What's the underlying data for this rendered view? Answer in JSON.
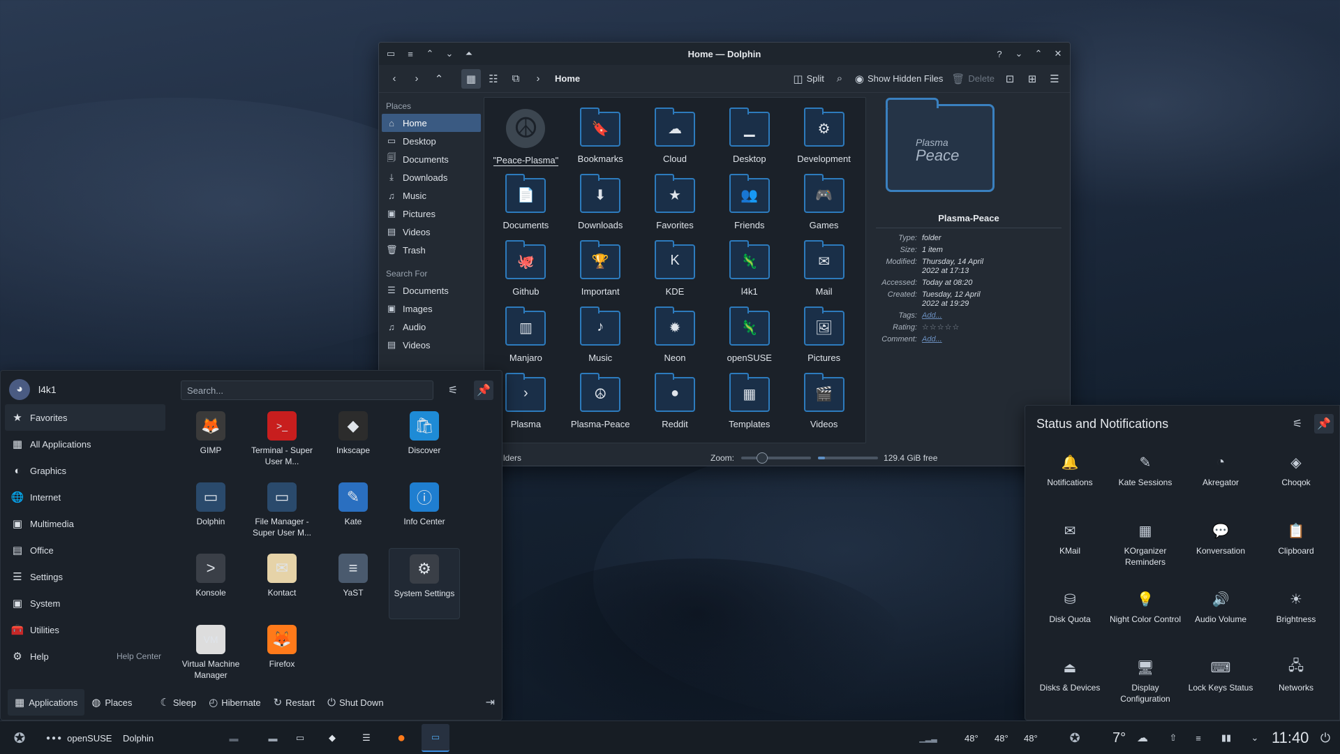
{
  "window": {
    "title": "Home — Dolphin",
    "buttons": {
      "help": "?",
      "minimize": "⌄",
      "maximize": "⌃",
      "close": "✕"
    }
  },
  "toolbar": {
    "breadcrumb": "Home",
    "split_label": "Split",
    "show_hidden_label": "Show Hidden Files",
    "delete_label": "Delete"
  },
  "places": {
    "header": "Places",
    "items": [
      {
        "label": "Home",
        "icon": "⌂"
      },
      {
        "label": "Desktop",
        "icon": "▭"
      },
      {
        "label": "Documents",
        "icon": "🗐"
      },
      {
        "label": "Downloads",
        "icon": "⤓"
      },
      {
        "label": "Music",
        "icon": "♫"
      },
      {
        "label": "Pictures",
        "icon": "▣"
      },
      {
        "label": "Videos",
        "icon": "▤"
      },
      {
        "label": "Trash",
        "icon": "🗑"
      }
    ],
    "search_header": "Search For",
    "search_items": [
      {
        "label": "Documents",
        "icon": "☰"
      },
      {
        "label": "Images",
        "icon": "▣"
      },
      {
        "label": "Audio",
        "icon": "♫"
      },
      {
        "label": "Videos",
        "icon": "▤"
      }
    ]
  },
  "files": [
    {
      "label": "\"Peace-Plasma\"",
      "icon": "☮"
    },
    {
      "label": "Bookmarks",
      "icon": "🔖"
    },
    {
      "label": "Cloud",
      "icon": "☁"
    },
    {
      "label": "Desktop",
      "icon": "▁"
    },
    {
      "label": "Development",
      "icon": "⚙"
    },
    {
      "label": "Documents",
      "icon": "📄"
    },
    {
      "label": "Downloads",
      "icon": "⬇"
    },
    {
      "label": "Favorites",
      "icon": "★"
    },
    {
      "label": "Friends",
      "icon": "👥"
    },
    {
      "label": "Games",
      "icon": "🎮"
    },
    {
      "label": "Github",
      "icon": "🐙"
    },
    {
      "label": "Important",
      "icon": "🏆"
    },
    {
      "label": "KDE",
      "icon": "K"
    },
    {
      "label": "l4k1",
      "icon": "🦎"
    },
    {
      "label": "Mail",
      "icon": "✉"
    },
    {
      "label": "Manjaro",
      "icon": "▥"
    },
    {
      "label": "Music",
      "icon": "♪"
    },
    {
      "label": "Neon",
      "icon": "✹"
    },
    {
      "label": "openSUSE",
      "icon": "🦎"
    },
    {
      "label": "Pictures",
      "icon": "🖼"
    },
    {
      "label": "Plasma",
      "icon": "›"
    },
    {
      "label": "Plasma-Peace",
      "icon": "☮"
    },
    {
      "label": "Reddit",
      "icon": "●"
    },
    {
      "label": "Templates",
      "icon": "▦"
    },
    {
      "label": "Videos",
      "icon": "🎬"
    }
  ],
  "info_panel": {
    "preview_small": "Plasma",
    "preview_big": "Peace",
    "name": "Plasma-Peace",
    "type_key": "Type:",
    "type": "folder",
    "size_key": "Size:",
    "size": "1 item",
    "modified_key": "Modified:",
    "modified": "Thursday, 14 April 2022 at 17:13",
    "accessed_key": "Accessed:",
    "accessed": "Today at 08:20",
    "created_key": "Created:",
    "created": "Tuesday, 12 April 2022 at 19:29",
    "tags_key": "Tags:",
    "tags": "Add...",
    "rating_key": "Rating:",
    "rating": "☆☆☆☆☆",
    "comment_key": "Comment:",
    "comment": "Add..."
  },
  "statusbar": {
    "left": "lders",
    "zoom_label": "Zoom:",
    "zoom_level": 0.3,
    "free_space": "129.4 GiB free",
    "used_fraction": 0.12
  },
  "launcher": {
    "username": "l4k1",
    "search_placeholder": "Search...",
    "categories": [
      {
        "label": "Favorites",
        "icon": "★"
      },
      {
        "label": "All Applications",
        "icon": "▦"
      },
      {
        "label": "Graphics",
        "icon": "◐"
      },
      {
        "label": "Internet",
        "icon": "🌐"
      },
      {
        "label": "Multimedia",
        "icon": "▣"
      },
      {
        "label": "Office",
        "icon": "▤"
      },
      {
        "label": "Settings",
        "icon": "☰"
      },
      {
        "label": "System",
        "icon": "▣"
      },
      {
        "label": "Utilities",
        "icon": "🧰"
      },
      {
        "label": "Help",
        "icon": "⚙"
      }
    ],
    "help_hint": "Help Center",
    "apps": [
      {
        "label": "GIMP",
        "icon": "🦊"
      },
      {
        "label": "Terminal - Super User M...",
        "icon": ">_"
      },
      {
        "label": "Inkscape",
        "icon": "◆"
      },
      {
        "label": "Discover",
        "icon": "🛍"
      },
      {
        "label": "Dolphin",
        "icon": "▭"
      },
      {
        "label": "File Manager - Super User M...",
        "icon": "▭"
      },
      {
        "label": "Kate",
        "icon": "✎"
      },
      {
        "label": "Info Center",
        "icon": "ⓘ"
      },
      {
        "label": "Konsole",
        "icon": ">"
      },
      {
        "label": "Kontact",
        "icon": "✉"
      },
      {
        "label": "YaST",
        "icon": "≡"
      },
      {
        "label": "System Settings",
        "icon": "⚙"
      },
      {
        "label": "Virtual Machine Manager",
        "icon": "VM"
      },
      {
        "label": "Firefox",
        "icon": "🦊"
      }
    ],
    "footer": {
      "applications": "Applications",
      "places": "Places",
      "sleep": "Sleep",
      "hibernate": "Hibernate",
      "restart": "Restart",
      "shutdown": "Shut Down"
    }
  },
  "system_tray_popup": {
    "title": "Status and Notifications",
    "items": [
      {
        "label": "Notifications",
        "icon": "🔔"
      },
      {
        "label": "Kate Sessions",
        "icon": "✎"
      },
      {
        "label": "Akregator",
        "icon": "◔"
      },
      {
        "label": "Choqok",
        "icon": "◈"
      },
      {
        "label": "KMail",
        "icon": "✉"
      },
      {
        "label": "KOrganizer Reminders",
        "icon": "▦"
      },
      {
        "label": "Konversation",
        "icon": "💬"
      },
      {
        "label": "Clipboard",
        "icon": "📋"
      },
      {
        "label": "Disk Quota",
        "icon": "⛁"
      },
      {
        "label": "Night Color Control",
        "icon": "💡"
      },
      {
        "label": "Audio Volume",
        "icon": "🔊"
      },
      {
        "label": "Brightness",
        "icon": "☀"
      },
      {
        "label": "Disks & Devices",
        "icon": "⏏"
      },
      {
        "label": "Display Configuration",
        "icon": "🖥"
      },
      {
        "label": "Lock Keys Status",
        "icon": "⌨"
      },
      {
        "label": "Networks",
        "icon": "🖧"
      }
    ]
  },
  "taskbar": {
    "activity": "openSUSE",
    "active_app": "Dolphin",
    "temps": [
      "48°",
      "48°",
      "48°"
    ],
    "weather": "7°",
    "clock": "11:40"
  },
  "colors": {
    "accent": "#3d8ee0",
    "folder": "#2d7bbd",
    "panel": "#1b2129"
  }
}
